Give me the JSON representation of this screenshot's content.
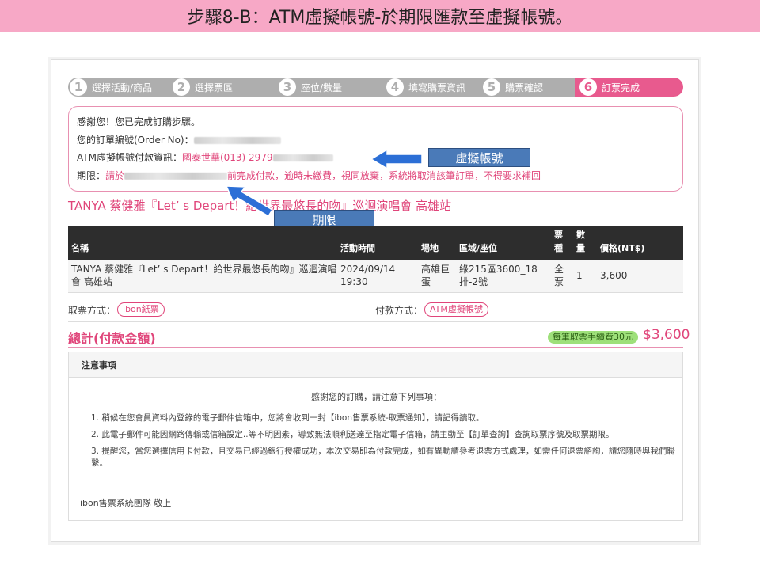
{
  "banner": {
    "title": "步驟8-B：ATM虛擬帳號-於期限匯款至虛擬帳號。"
  },
  "steps": [
    {
      "num": "1",
      "label": "選擇活動/商品"
    },
    {
      "num": "2",
      "label": "選擇票區"
    },
    {
      "num": "3",
      "label": "座位/數量"
    },
    {
      "num": "4",
      "label": "填寫購票資訊"
    },
    {
      "num": "5",
      "label": "購票確認"
    },
    {
      "num": "6",
      "label": "訂票完成"
    }
  ],
  "info": {
    "thanks": "感謝您！您已完成訂購步驟。",
    "order_label": "您的訂單編號(Order  No)：",
    "atm_label": "ATM虛擬帳號付款資訊：",
    "atm_bank": "國泰世華(013)  2979",
    "deadline_label": "期限：",
    "deadline_prefix": "請於",
    "deadline_suffix": "前完成付款，逾時未繳費，視同放棄，系統將取消該筆訂單，不得要求補回"
  },
  "callouts": {
    "virtual_account": "虛擬帳號",
    "deadline": "期限"
  },
  "event_title": "TANYA 蔡健雅『Let’ s Depart！給世界最悠長的吻』巡迴演唱會 高雄站",
  "table": {
    "headers": {
      "name": "名稱",
      "time": "活動時間",
      "venue": "場地",
      "seat": "區域/座位",
      "type": "票種",
      "qty": "數量",
      "price": "價格(NT$)"
    },
    "row": {
      "name": "TANYA 蔡健雅『Let’ s Depart！給世界最悠長的吻』巡迴演唱會 高雄站",
      "date": "2024/09/14",
      "time": "19:30",
      "venue": "高雄巨蛋",
      "seat": "綠215區3600_18排-2號",
      "type": "全票",
      "qty": "1",
      "price": "3,600"
    }
  },
  "pickup": {
    "label": "取票方式：",
    "value": "ibon紙票"
  },
  "payment": {
    "label": "付款方式：",
    "value": "ATM虛擬帳號"
  },
  "total": {
    "label": "總計(付款金額)",
    "fee_note": "每筆取票手續費30元",
    "amount": "$3,600"
  },
  "notes": {
    "title": "注意事項",
    "intro": "感謝您的訂購，請注意下列事項：",
    "items": [
      "1.  稍候在您會員資料內登錄的電子郵件信箱中，您將會收到一封【ibon售票系統-取票通知】，請記得讀取。",
      "2.  此電子郵件可能因網路傳輸或信箱設定..等不明因素，導致無法順利送達至指定電子信箱，請主動至【訂單查詢】查詢取票序號及取票期限。",
      "3.  提醒您，當您選擇信用卡付款，且交易已經過銀行授權成功，本次交易即為付款完成，如有異動請參考退票方式處理，如需任何退票諮詢，請您隨時與我們聯繫。"
    ],
    "sign": "ibon售票系統團隊  敬上"
  },
  "colors": {
    "accent": "#e0457a",
    "banner": "#f7a8c6",
    "callout": "#4a7ab8",
    "step_inactive": "#aeaeae"
  }
}
